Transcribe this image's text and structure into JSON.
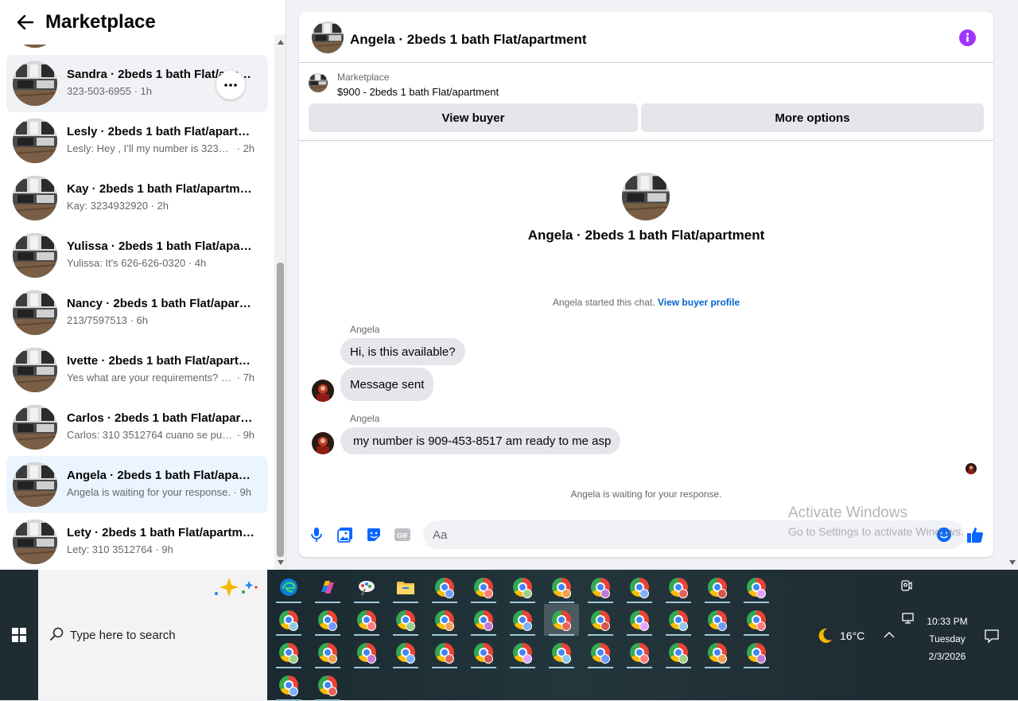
{
  "left_panel": {
    "title": "Marketplace",
    "conversations": [
      {
        "name": "Sandra · 2beds 1 bath Flat/apartment",
        "message": "323-503-6955",
        "time": "1h",
        "state": "hover"
      },
      {
        "name": "Lesly · 2beds 1 bath Flat/apartment",
        "message": "Lesly: Hey , I’ll my number is 32353...",
        "time": "2h",
        "state": ""
      },
      {
        "name": "Kay · 2beds 1 bath Flat/apartment",
        "message": "Kay: 3234932920",
        "time": "2h",
        "state": ""
      },
      {
        "name": "Yulissa · 2beds 1 bath Flat/apartment",
        "message": "Yulissa: It's 626-626-0320",
        "time": "4h",
        "state": ""
      },
      {
        "name": "Nancy · 2beds 1 bath Flat/apartment",
        "message": "213/7597513",
        "time": "6h",
        "state": ""
      },
      {
        "name": "Ivette · 2beds 1 bath Flat/apartment",
        "message": "Yes what are your requirements? 5...",
        "time": "7h",
        "state": ""
      },
      {
        "name": "Carlos · 2beds 1 bath Flat/apartment",
        "message": "Carlos: 310 3512764 cuano se pued...",
        "time": "9h",
        "state": ""
      },
      {
        "name": "Angela · 2beds 1 bath Flat/apartment",
        "message": "Angela is waiting for your response.",
        "time": "9h",
        "state": "active"
      },
      {
        "name": "Lety · 2beds 1 bath Flat/apartment",
        "message": "Lety: 310 3512764",
        "time": "9h",
        "state": ""
      }
    ]
  },
  "chat": {
    "title": "Angela · 2beds 1 bath Flat/apartment",
    "listing_label": "Marketplace",
    "listing_price": "$900 - 2beds 1 bath Flat/apartment",
    "view_buyer": "View buyer",
    "more_options": "More options",
    "profile_name": "Angela · 2beds 1 bath Flat/apartment",
    "started_text": "Angela started this chat.",
    "view_profile_link": "View buyer profile",
    "sender": "Angela",
    "messages": [
      "Hi, is this available?",
      "Message sent",
      "my number is 909-453-8517 am ready to me asp"
    ],
    "waiting_text": "Angela is waiting for your response.",
    "input_placeholder": "Aa",
    "accent_color": "#0866ff",
    "info_color": "#a033ff"
  },
  "watermark": {
    "line1": "Activate Windows",
    "line2": "Go to Settings to activate Windows."
  },
  "taskbar": {
    "search_placeholder": "Type here to search",
    "weather": "16°C",
    "time": "10:33 PM",
    "day": "Tuesday",
    "date": "2/3/2026"
  }
}
